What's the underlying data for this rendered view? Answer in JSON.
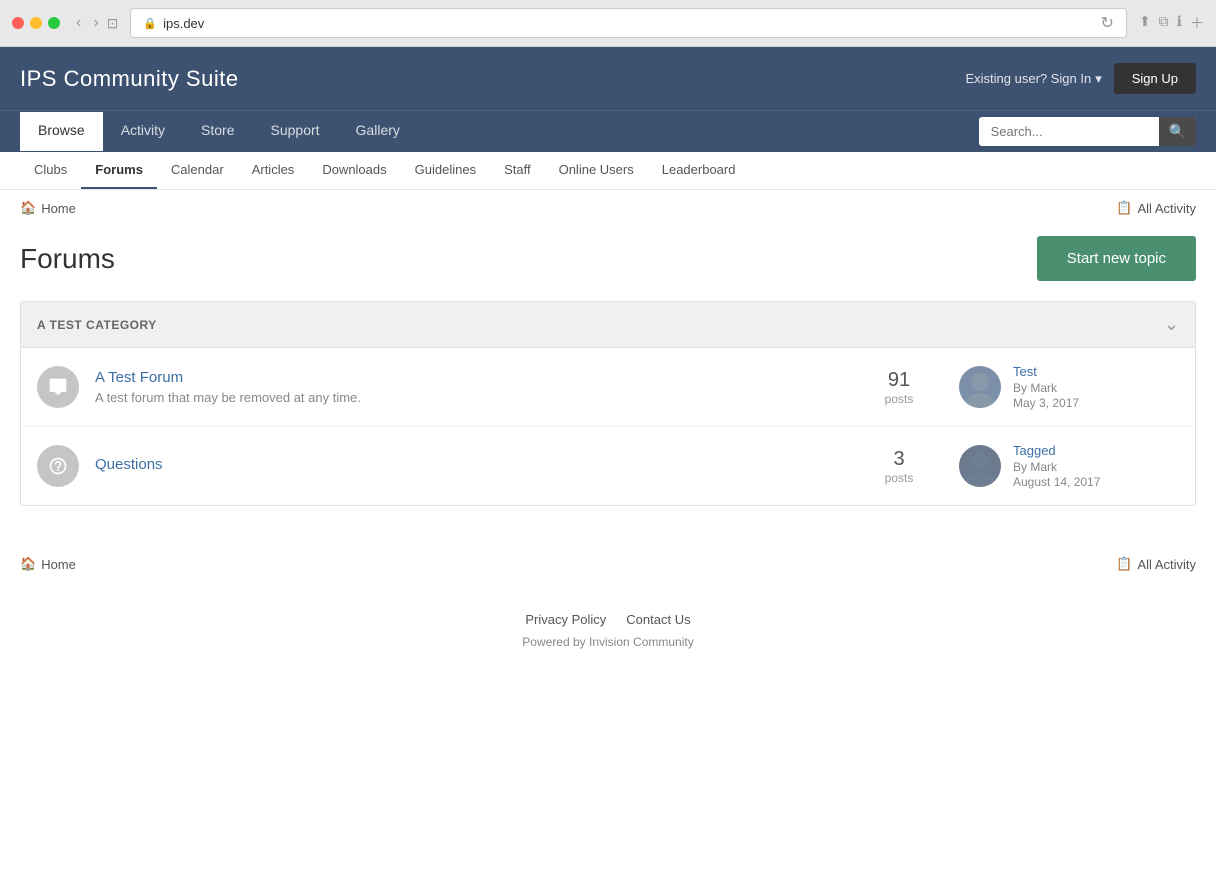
{
  "browser": {
    "url": "ips.dev",
    "reload_label": "↻"
  },
  "site": {
    "title": "IPS Community Suite"
  },
  "header": {
    "sign_in_label": "Existing user? Sign In",
    "sign_in_arrow": "▾",
    "sign_up_label": "Sign Up"
  },
  "main_nav": {
    "tabs": [
      {
        "label": "Browse",
        "active": true
      },
      {
        "label": "Activity"
      },
      {
        "label": "Store"
      },
      {
        "label": "Support"
      },
      {
        "label": "Gallery"
      }
    ],
    "search_placeholder": "Search..."
  },
  "sub_nav": {
    "items": [
      {
        "label": "Clubs"
      },
      {
        "label": "Forums",
        "active": true
      },
      {
        "label": "Calendar"
      },
      {
        "label": "Articles"
      },
      {
        "label": "Downloads"
      },
      {
        "label": "Guidelines"
      },
      {
        "label": "Staff"
      },
      {
        "label": "Online Users"
      },
      {
        "label": "Leaderboard"
      }
    ]
  },
  "breadcrumb": {
    "home_label": "Home",
    "all_activity_label": "All Activity"
  },
  "page": {
    "title": "Forums",
    "start_new_topic_label": "Start new topic"
  },
  "category": {
    "title": "A TEST CATEGORY",
    "forums": [
      {
        "id": "a-test-forum",
        "name": "A Test Forum",
        "description": "A test forum that may be removed at any time.",
        "post_count": 91,
        "posts_label": "posts",
        "last_post_title": "Test",
        "last_post_by": "By Mark",
        "last_post_date": "May 3, 2017"
      },
      {
        "id": "questions",
        "name": "Questions",
        "description": "",
        "post_count": 3,
        "posts_label": "posts",
        "last_post_title": "Tagged",
        "last_post_by": "By Mark",
        "last_post_date": "August 14, 2017"
      }
    ]
  },
  "footer_breadcrumb": {
    "home_label": "Home",
    "all_activity_label": "All Activity"
  },
  "footer": {
    "privacy_policy_label": "Privacy Policy",
    "contact_us_label": "Contact Us",
    "powered_by": "Powered by Invision Community"
  }
}
